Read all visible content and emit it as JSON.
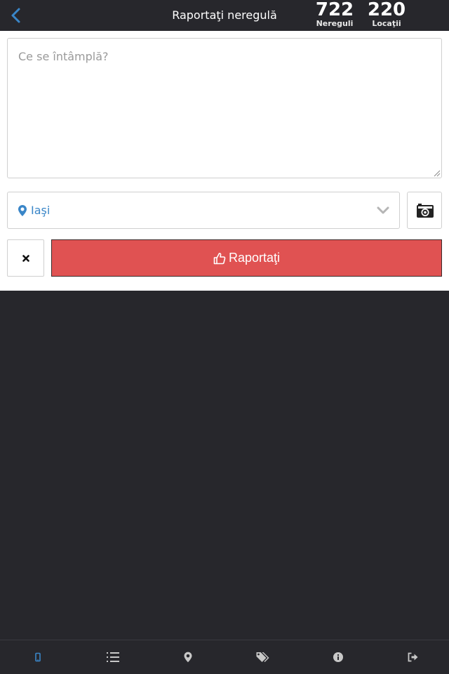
{
  "header": {
    "title": "Raportaţi neregulă",
    "stats": {
      "issues": {
        "value": "722",
        "label": "Nereguli"
      },
      "locations": {
        "value": "220",
        "label": "Locaţii"
      }
    }
  },
  "form": {
    "description": {
      "placeholder": "Ce se întâmplă?",
      "value": ""
    },
    "location": {
      "selected": "Iaşi",
      "icon": "map-marker-icon"
    },
    "camera_icon": "camera-icon",
    "cancel_icon": "close-icon",
    "report_button": {
      "label": "Raportaţi",
      "icon": "thumbs-up-icon"
    }
  },
  "bottom_nav": {
    "items": [
      {
        "icon": "mobile-icon",
        "active": true
      },
      {
        "icon": "ordered-list-icon",
        "active": false
      },
      {
        "icon": "map-marker-icon",
        "active": false
      },
      {
        "icon": "tags-icon",
        "active": false
      },
      {
        "icon": "info-icon",
        "active": false
      },
      {
        "icon": "sign-out-icon",
        "active": false
      }
    ]
  },
  "colors": {
    "background_dark": "#27272c",
    "accent_blue": "#3a86c8",
    "report_red": "#e05252",
    "border_gray": "#cfcfcf"
  }
}
